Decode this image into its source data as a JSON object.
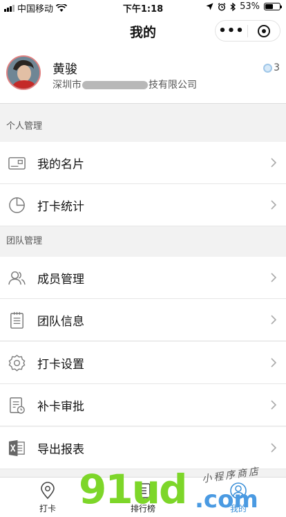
{
  "status_bar": {
    "carrier": "中国移动",
    "time": "下午1:18",
    "battery": "53%",
    "battery_level": 0.53
  },
  "nav": {
    "title": "我的",
    "more_icon": "more-dots-icon",
    "close_icon": "target-close-icon"
  },
  "profile": {
    "name": "黄骏",
    "company_prefix": "深圳市",
    "company_suffix": "技有限公司",
    "points": "3"
  },
  "sections": [
    {
      "title": "个人管理"
    },
    {
      "title": "团队管理"
    }
  ],
  "menu": {
    "business_card": {
      "label": "我的名片",
      "icon": "card-icon"
    },
    "checkin_stats": {
      "label": "打卡统计",
      "icon": "pie-chart-icon"
    },
    "member_manage": {
      "label": "成员管理",
      "icon": "members-icon"
    },
    "team_info": {
      "label": "团队信息",
      "icon": "clipboard-icon"
    },
    "checkin_settings": {
      "label": "打卡设置",
      "icon": "settings-icon"
    },
    "makeup_approval": {
      "label": "补卡审批",
      "icon": "approval-icon"
    },
    "export_report": {
      "label": "导出报表",
      "icon": "excel-icon"
    }
  },
  "tabs": [
    {
      "label": "打卡",
      "icon": "location-pin-icon",
      "active": false
    },
    {
      "label": "排行榜",
      "icon": "list-icon",
      "active": false
    },
    {
      "label": "我的",
      "icon": "user-icon",
      "active": true
    }
  ],
  "watermark": {
    "main": "91ud",
    "suffix": ".com",
    "script": "小程序商店"
  },
  "colors": {
    "accent": "#3a8fd8",
    "watermark_green": "#7dd629",
    "watermark_blue": "#4a9ae2"
  }
}
